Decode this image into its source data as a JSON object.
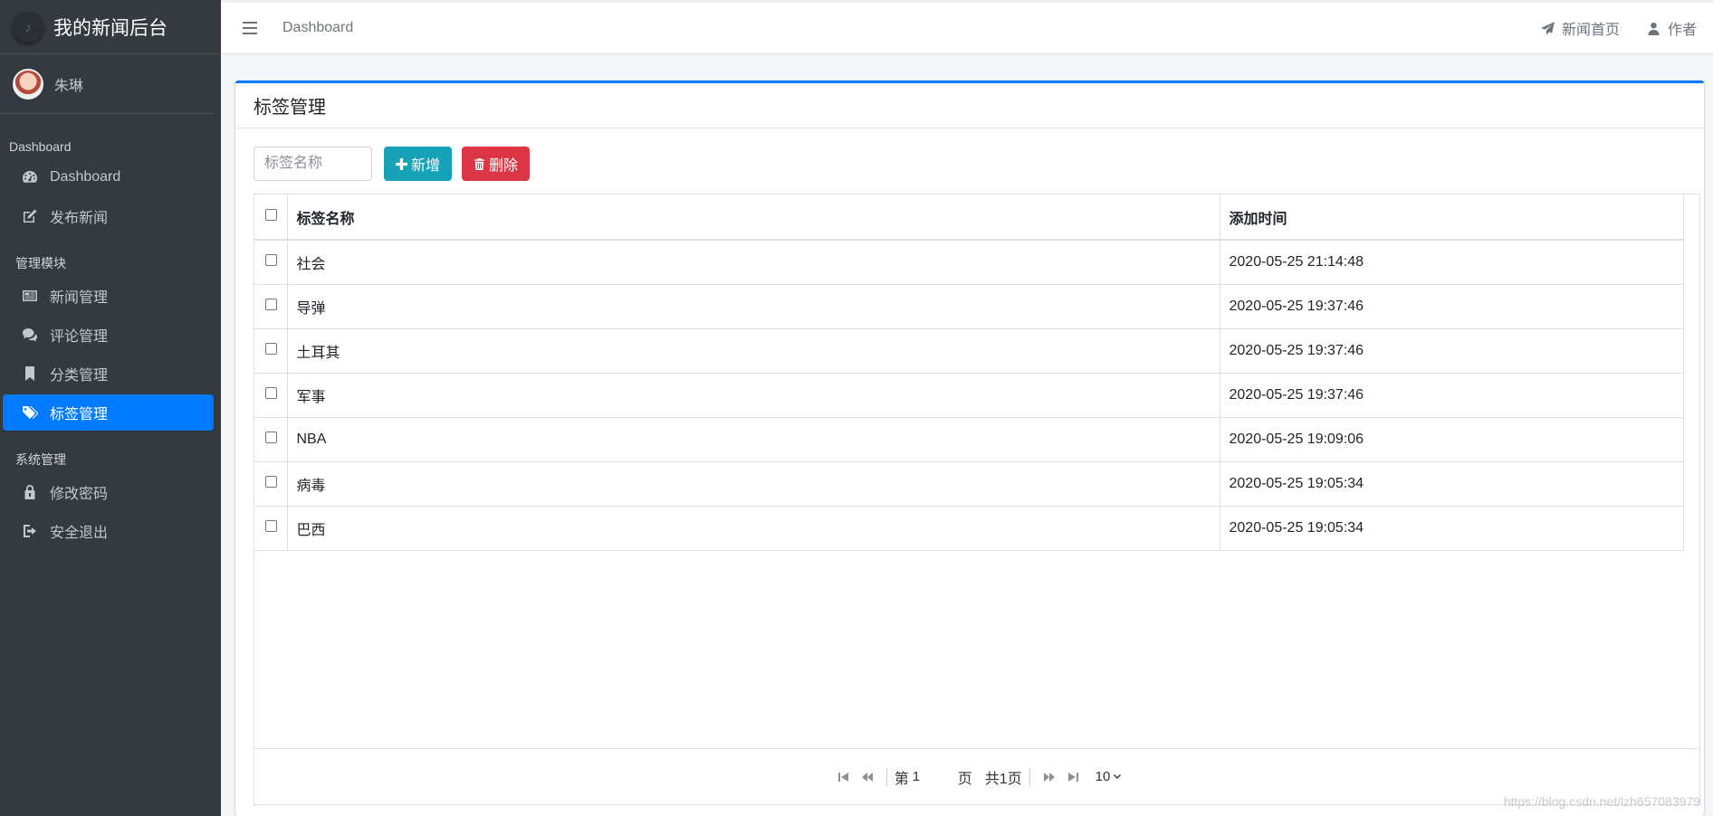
{
  "brand": {
    "title": "我的新闻后台"
  },
  "user": {
    "name": "朱琳"
  },
  "sidebar": {
    "sections": [
      {
        "header": "Dashboard",
        "items": [
          {
            "label": "Dashboard",
            "icon": "dashboard-icon"
          },
          {
            "label": "发布新闻",
            "icon": "edit-icon"
          }
        ]
      },
      {
        "header": "管理模块",
        "items": [
          {
            "label": "新闻管理",
            "icon": "newspaper-icon"
          },
          {
            "label": "评论管理",
            "icon": "comments-icon"
          },
          {
            "label": "分类管理",
            "icon": "bookmark-icon"
          },
          {
            "label": "标签管理",
            "icon": "tags-icon",
            "active": true
          }
        ]
      },
      {
        "header": "系统管理",
        "items": [
          {
            "label": "修改密码",
            "icon": "lock-icon"
          },
          {
            "label": "安全退出",
            "icon": "sign-out-icon"
          }
        ]
      }
    ]
  },
  "topbar": {
    "breadcrumb": "Dashboard",
    "news_home": "新闻首页",
    "author": "作者"
  },
  "card": {
    "title": "标签管理",
    "search_placeholder": "标签名称",
    "add_label": "新增",
    "delete_label": "删除"
  },
  "table": {
    "headers": {
      "name": "标签名称",
      "time": "添加时间"
    },
    "rows": [
      {
        "name": "社会",
        "time": "2020-05-25 21:14:48"
      },
      {
        "name": "导弹",
        "time": "2020-05-25 19:37:46"
      },
      {
        "name": "土耳其",
        "time": "2020-05-25 19:37:46"
      },
      {
        "name": "军事",
        "time": "2020-05-25 19:37:46"
      },
      {
        "name": "NBA",
        "time": "2020-05-25 19:09:06"
      },
      {
        "name": "病毒",
        "time": "2020-05-25 19:05:34"
      },
      {
        "name": "巴西",
        "time": "2020-05-25 19:05:34"
      }
    ]
  },
  "pager": {
    "page_prefix": "第",
    "page_value": "1",
    "page_suffix": "页",
    "total": "共1页",
    "page_size": "10"
  },
  "watermark": "https://blog.csdn.net/lzh657083979",
  "colors": {
    "primary": "#007bff",
    "info": "#17a2b8",
    "danger": "#dc3545",
    "sidebar": "#343a40"
  }
}
